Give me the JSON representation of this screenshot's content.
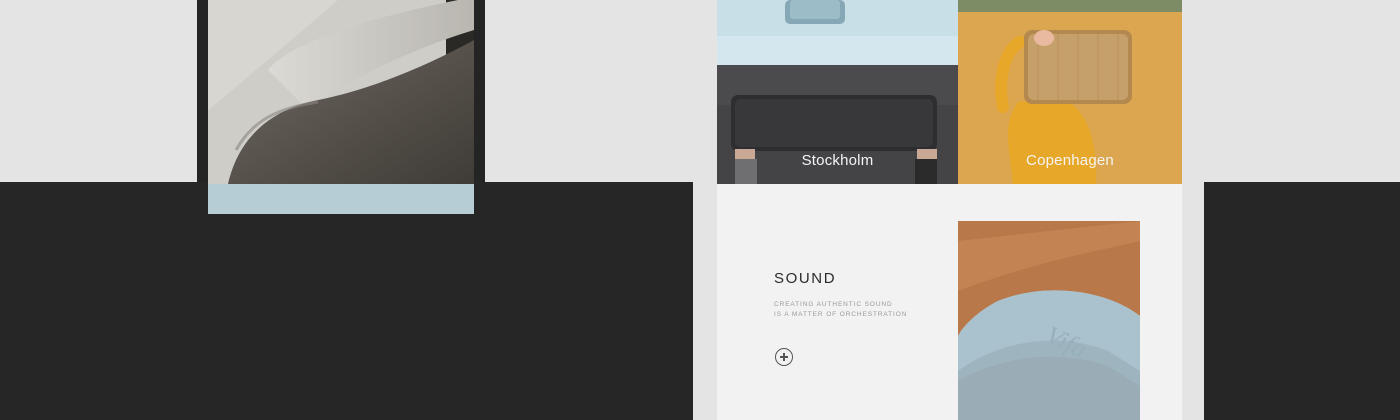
{
  "tiles": [
    {
      "name": "Stockholm"
    },
    {
      "name": "Copenhagen"
    }
  ],
  "sound": {
    "title": "SOUND",
    "line1": "CREATING AUTHENTIC SOUND",
    "line2": "IS A MATTER OF ORCHESTRATION"
  },
  "brand_emboss": "Vifa",
  "colors": {
    "dark": "#262626",
    "light_bg": "#e4e4e4",
    "panel": "#f2f2f2",
    "pale_blue": "#c7dde6",
    "olive": "#7e8c66",
    "charcoal": "#434345",
    "ochre": "#dba24c",
    "leather": "#b8784a"
  },
  "icons": {
    "expand": "plus-circle-icon"
  }
}
